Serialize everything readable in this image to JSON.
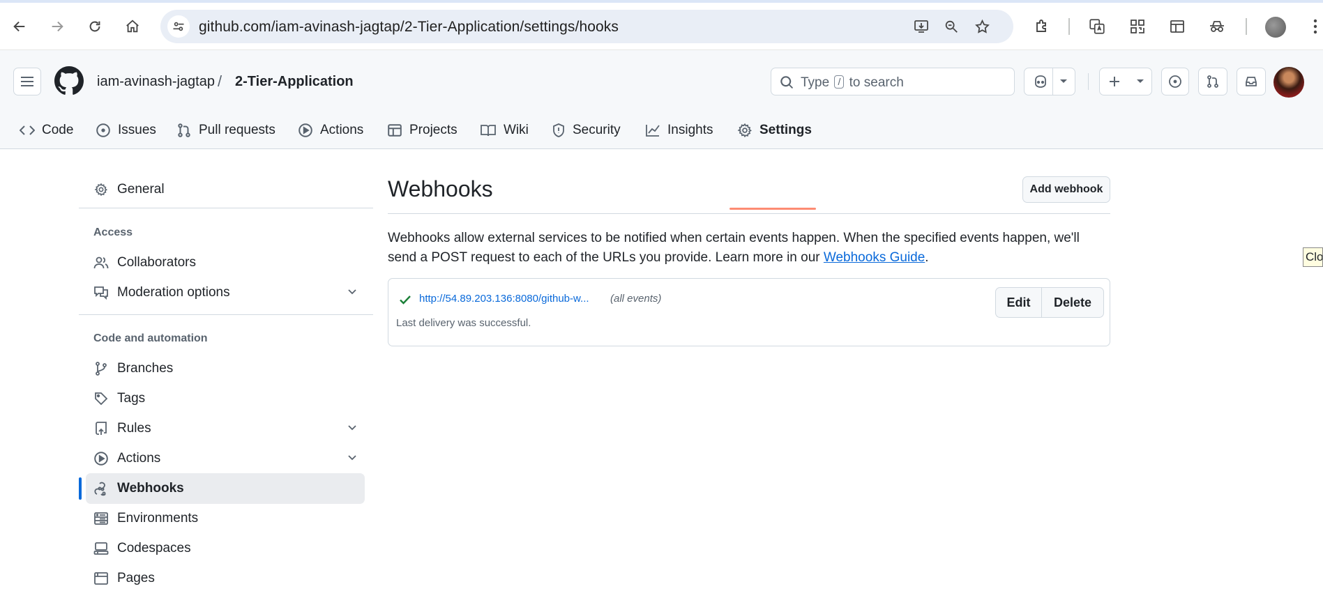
{
  "browser": {
    "url": "github.com/iam-avinash-jagtap/2-Tier-Application/settings/hooks"
  },
  "header": {
    "owner": "iam-avinash-jagtap",
    "separator": "/",
    "repo": "2-Tier-Application",
    "search": {
      "prefix": "Type",
      "key": "/",
      "suffix": "to search"
    }
  },
  "tabs": [
    {
      "label": "Code",
      "icon": "code-icon"
    },
    {
      "label": "Issues",
      "icon": "issue-opened-icon"
    },
    {
      "label": "Pull requests",
      "icon": "git-pull-request-icon"
    },
    {
      "label": "Actions",
      "icon": "play-icon"
    },
    {
      "label": "Projects",
      "icon": "table-icon"
    },
    {
      "label": "Wiki",
      "icon": "book-icon"
    },
    {
      "label": "Security",
      "icon": "shield-icon"
    },
    {
      "label": "Insights",
      "icon": "graph-icon"
    },
    {
      "label": "Settings",
      "icon": "gear-icon",
      "active": true
    }
  ],
  "sidebar": {
    "general": "General",
    "access_heading": "Access",
    "collaborators": "Collaborators",
    "moderation": "Moderation options",
    "code_heading": "Code and automation",
    "branches": "Branches",
    "tags": "Tags",
    "rules": "Rules",
    "actions": "Actions",
    "webhooks": "Webhooks",
    "environments": "Environments",
    "codespaces": "Codespaces",
    "pages": "Pages"
  },
  "main": {
    "title": "Webhooks",
    "add_button": "Add webhook",
    "description": "Webhooks allow external services to be notified when certain events happen. When the specified events happen, we'll send a POST request to each of the URLs you provide. Learn more in our ",
    "guide_link": "Webhooks Guide",
    "description_end": ".",
    "hook": {
      "url": "http://54.89.203.136:8080/github-w...",
      "events": "(all events)",
      "status": "Last delivery was successful.",
      "edit": "Edit",
      "delete": "Delete"
    }
  },
  "tooltip_fragment": "Clo",
  "colors": {
    "accent": "#0969da",
    "active_tab_underline": "#fd8c73",
    "success": "#1a7f37"
  }
}
